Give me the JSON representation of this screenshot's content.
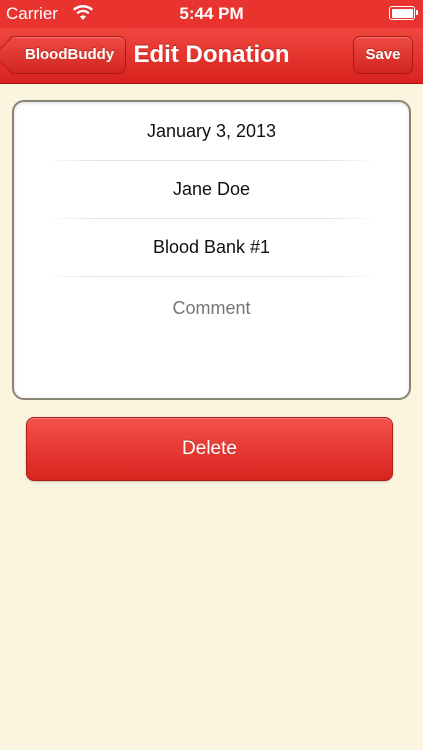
{
  "status_bar": {
    "carrier": "Carrier",
    "time": "5:44 PM",
    "wifi_icon": "wifi-icon",
    "battery_icon": "battery-icon"
  },
  "nav": {
    "back_label": "BloodBuddy",
    "title": "Edit Donation",
    "save_label": "Save"
  },
  "form": {
    "date": "January 3, 2013",
    "donor": "Jane Doe",
    "location": "Blood Bank #1",
    "comment_placeholder": "Comment",
    "comment_value": ""
  },
  "actions": {
    "delete_label": "Delete"
  },
  "colors": {
    "accent_red": "#e8332f",
    "background": "#fbf5e0",
    "card_border": "#8a8475",
    "placeholder": "#b5b5b5"
  }
}
